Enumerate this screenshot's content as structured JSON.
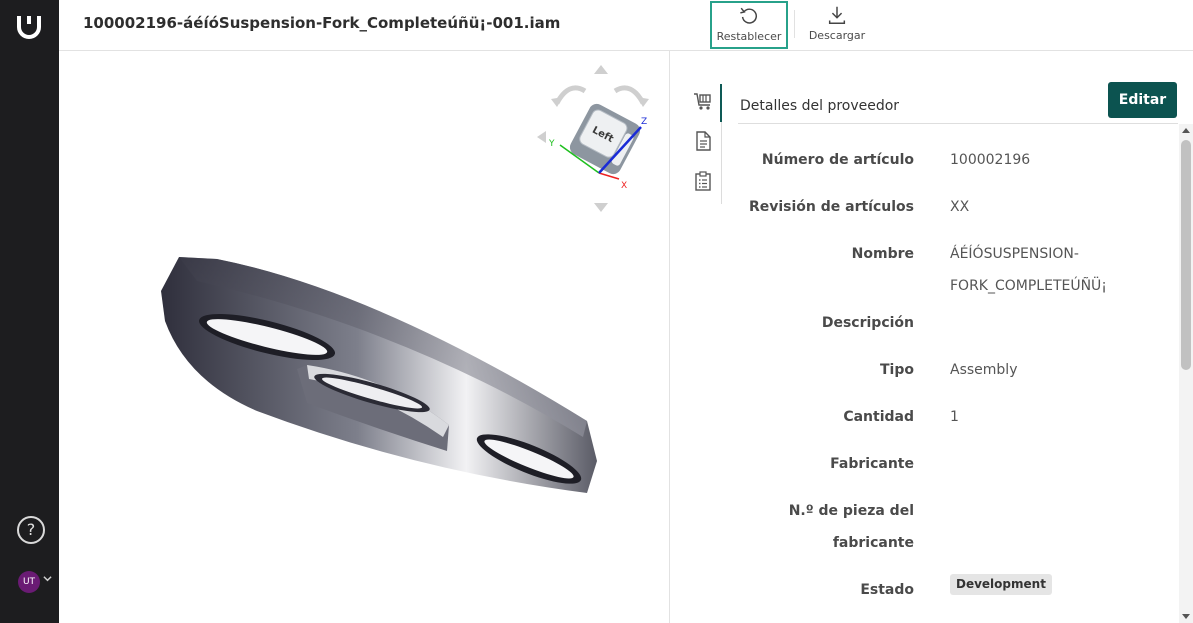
{
  "header": {
    "file_title": "100002196-áéíóSuspension-Fork_Completeúñü¡-001.iam",
    "reset_label": "Restablecer",
    "download_label": "Descargar"
  },
  "rail": {
    "help_label": "?",
    "avatar_initials": "UT"
  },
  "viewcube": {
    "face_label": "Left",
    "axis_x": "X",
    "axis_y": "Y",
    "axis_z": "Z"
  },
  "panel": {
    "title": "Detalles del proveedor",
    "edit_label": "Editar",
    "properties": [
      {
        "label": "Número de artículo",
        "value": "100002196"
      },
      {
        "label": "Revisión de artículos",
        "value": "XX"
      },
      {
        "label": "Nombre",
        "value_line1": "ÁÉÍÓSUSPENSION-",
        "value_line2": "FORK_COMPLETEÚÑÜ¡"
      },
      {
        "label": "Descripción",
        "value": ""
      },
      {
        "label": "Tipo",
        "value": "Assembly"
      },
      {
        "label": "Cantidad",
        "value": "1"
      },
      {
        "label": "Fabricante",
        "value": ""
      },
      {
        "label_line1": "N.º de pieza del",
        "label_line2": "fabricante",
        "value": ""
      },
      {
        "label": "Estado",
        "value": "Development"
      }
    ]
  },
  "colors": {
    "accent": "#0c5350",
    "highlight_border": "#27a18a",
    "rail_bg": "#1d1d1f",
    "avatar_bg": "#6a1b74"
  },
  "icons": {
    "logo": "brand-logo-icon",
    "reset": "rotate-ccw-icon",
    "download": "download-icon",
    "help": "help-circle-icon",
    "chevron": "chevron-down-icon",
    "tab1": "vendor-cart-icon",
    "tab2": "document-icon",
    "tab3": "clipboard-list-icon"
  }
}
